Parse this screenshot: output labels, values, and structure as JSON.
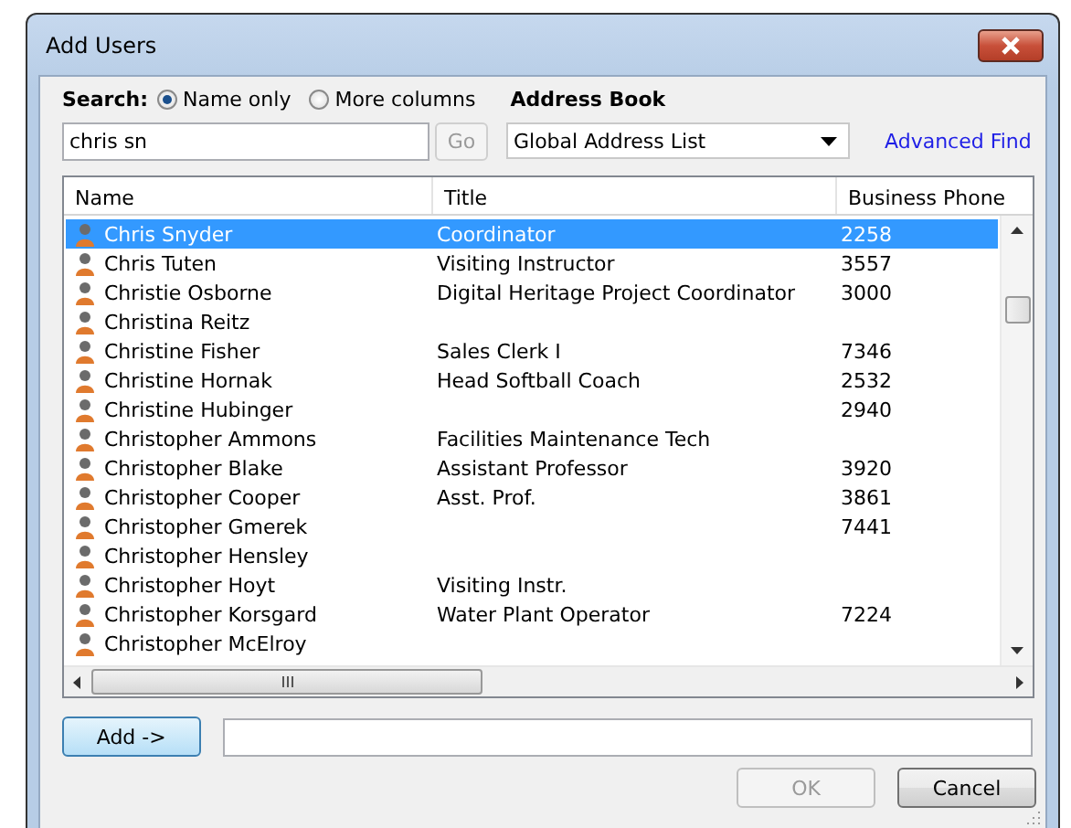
{
  "window": {
    "title": "Add Users"
  },
  "search": {
    "label": "Search:",
    "value": "chris sn",
    "go": {
      "label": "Go",
      "disabled": true
    },
    "options": [
      {
        "label": "Name only",
        "selected": true
      },
      {
        "label": "More columns",
        "selected": false
      }
    ]
  },
  "address_book": {
    "label": "Address Book",
    "value": "Global Address List"
  },
  "advanced_find": {
    "label": "Advanced Find"
  },
  "table": {
    "columns": [
      "Name",
      "Title",
      "Business Phone"
    ],
    "rows": [
      {
        "name": "Chris Snyder",
        "title": "Coordinator",
        "phone": "2258",
        "selected": true
      },
      {
        "name": "Chris Tuten",
        "title": "Visiting Instructor",
        "phone": "3557",
        "selected": false
      },
      {
        "name": "Christie Osborne",
        "title": "Digital Heritage Project Coordinator",
        "phone": "3000",
        "selected": false
      },
      {
        "name": "Christina Reitz",
        "title": "",
        "phone": "",
        "selected": false
      },
      {
        "name": "Christine Fisher",
        "title": "Sales Clerk I",
        "phone": "7346",
        "selected": false
      },
      {
        "name": "Christine Hornak",
        "title": "Head Softball Coach",
        "phone": "2532",
        "selected": false
      },
      {
        "name": "Christine Hubinger",
        "title": "",
        "phone": "2940",
        "selected": false
      },
      {
        "name": "Christopher Ammons",
        "title": "Facilities Maintenance Tech",
        "phone": "",
        "selected": false
      },
      {
        "name": "Christopher Blake",
        "title": "Assistant Professor",
        "phone": "3920",
        "selected": false
      },
      {
        "name": "Christopher Cooper",
        "title": "Asst. Prof.",
        "phone": "3861",
        "selected": false
      },
      {
        "name": "Christopher Gmerek",
        "title": "",
        "phone": "7441",
        "selected": false
      },
      {
        "name": "Christopher Hensley",
        "title": "",
        "phone": "",
        "selected": false
      },
      {
        "name": "Christopher Hoyt",
        "title": "Visiting Instr.",
        "phone": "",
        "selected": false
      },
      {
        "name": "Christopher Korsgard",
        "title": "Water Plant Operator",
        "phone": "7224",
        "selected": false
      },
      {
        "name": "Christopher McElroy",
        "title": "",
        "phone": "",
        "selected": false
      }
    ]
  },
  "add_button": {
    "label": "Add ->"
  },
  "buttons": [
    {
      "label": "OK",
      "disabled": true
    },
    {
      "label": "Cancel",
      "disabled": false
    }
  ]
}
